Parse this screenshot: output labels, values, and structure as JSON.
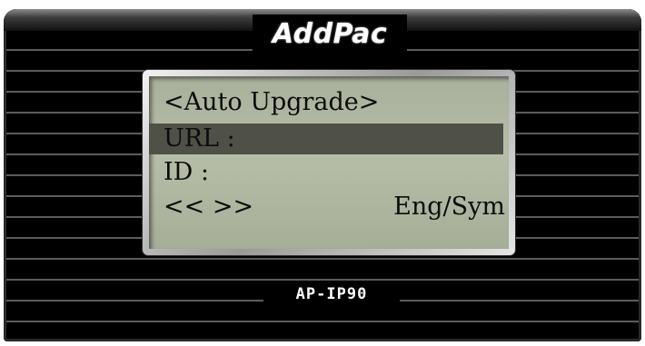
{
  "device": {
    "brand": "AddPac",
    "model": "AP-IP90"
  },
  "lcd": {
    "title": "<Auto Upgrade>",
    "url_label": "URL :",
    "id_label": "ID :",
    "nav_left": "<< >>",
    "input_mode": "Eng/Sym",
    "highlighted_row": "url"
  },
  "colors": {
    "bezel": "#000000",
    "bezel_stripe": "#5c5c5c",
    "lcd_background": "#b0b8a2",
    "lcd_highlight": "#4f5147",
    "lcd_text": "#0c0c0c"
  }
}
